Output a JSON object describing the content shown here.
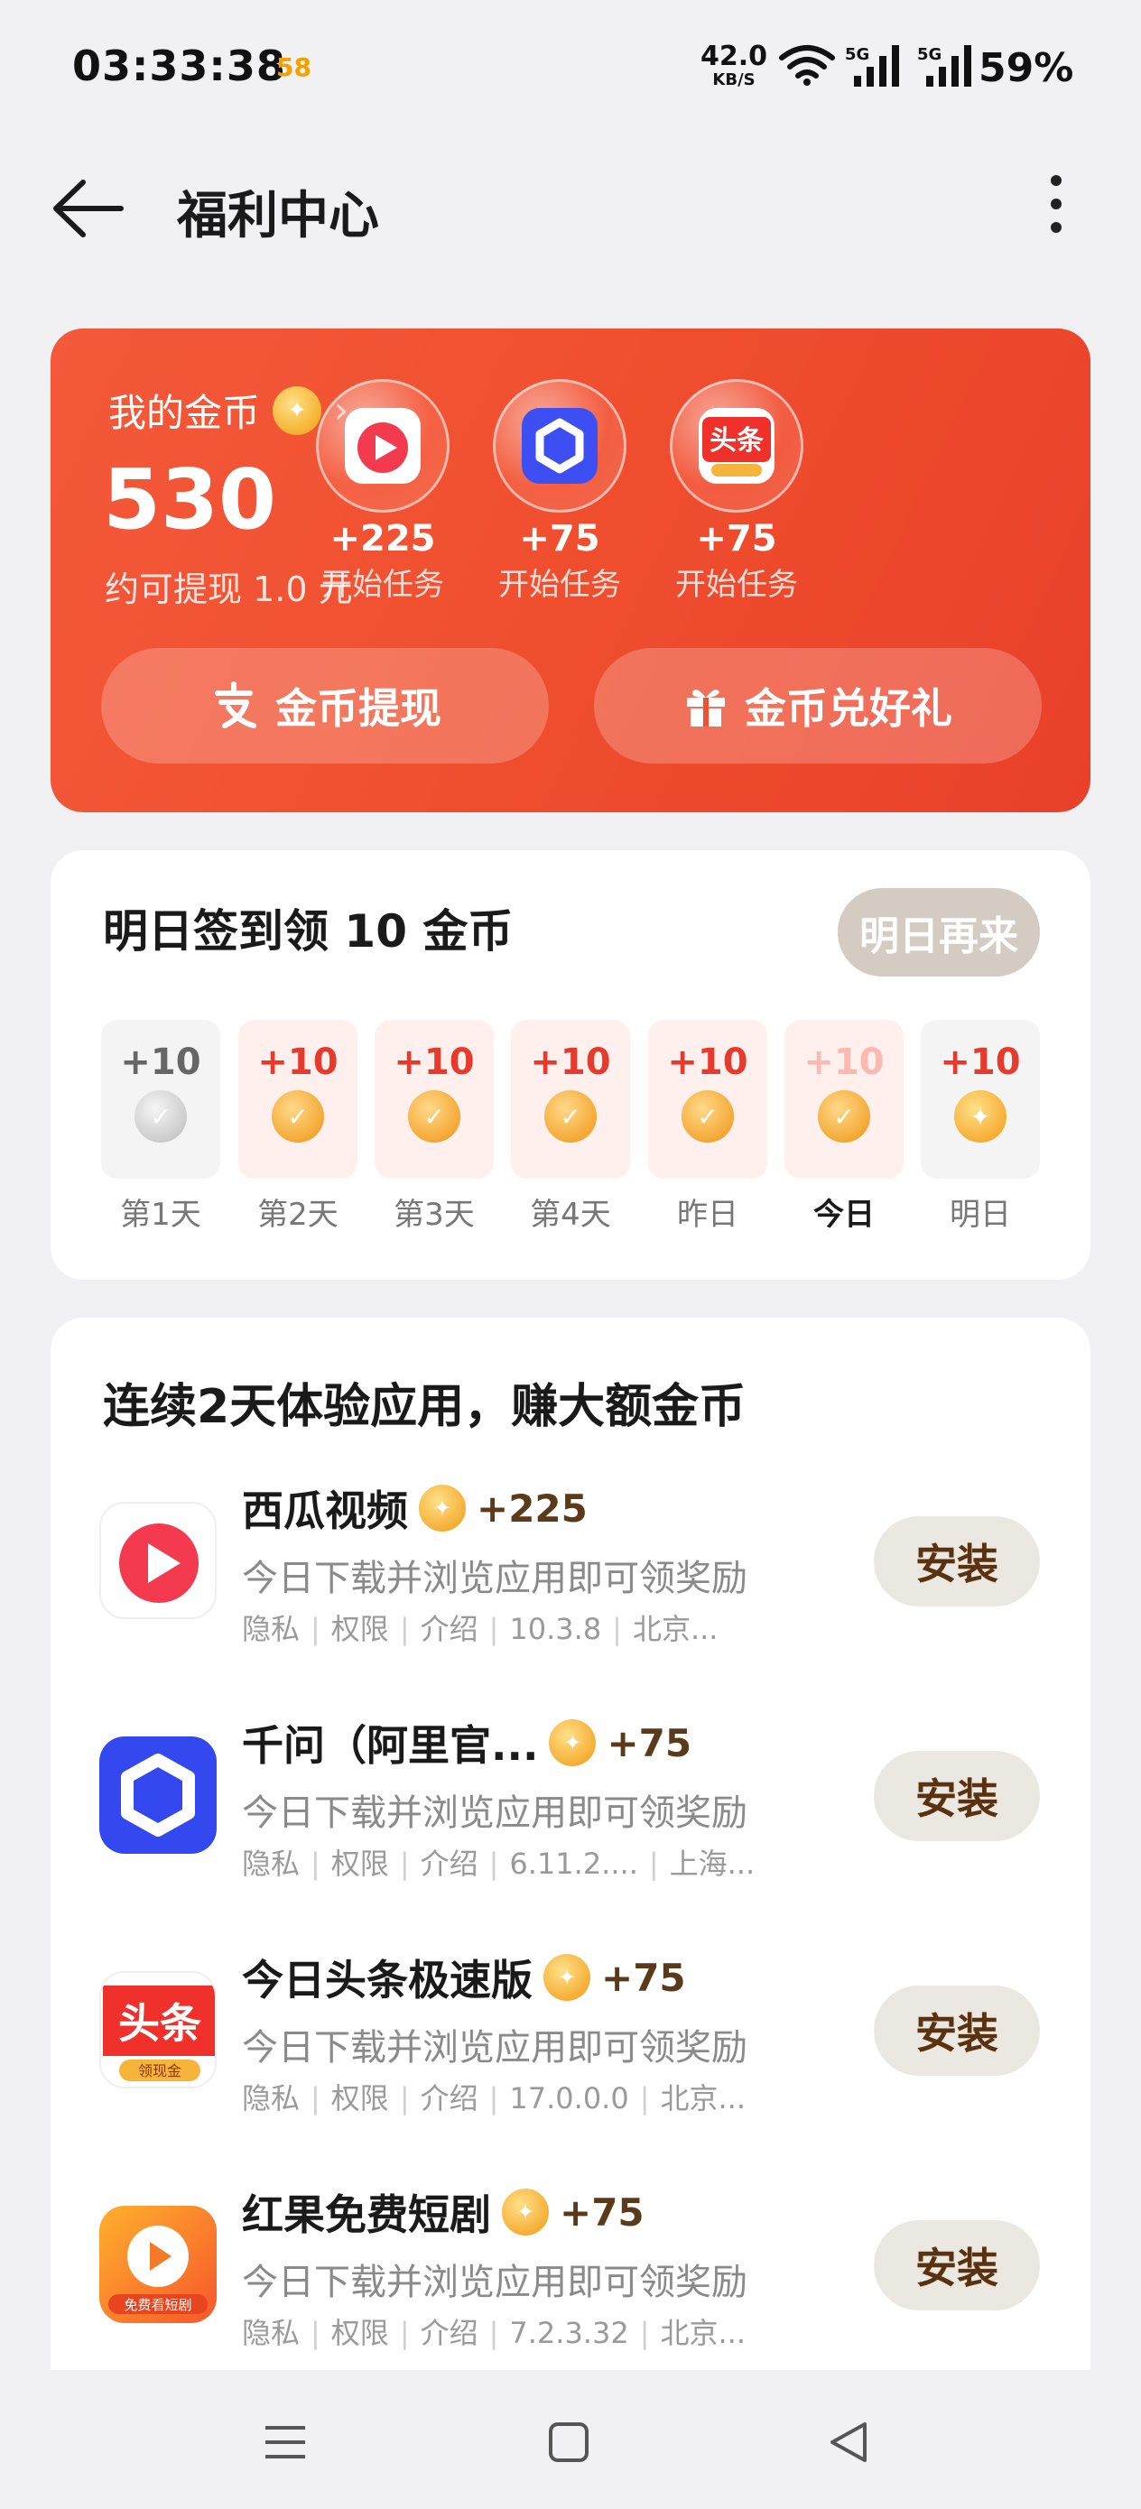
{
  "status_bar": {
    "time": "03:33:38",
    "app_icon_text": "58",
    "speed_value": "42.0",
    "speed_unit": "KB/S",
    "sim1_label": "5G",
    "sim2_label": "5G",
    "battery": "59%"
  },
  "header": {
    "title": "福利中心"
  },
  "coin_card": {
    "label": "我的金币",
    "amount": "530",
    "withdraw_hint": "约可提现 1.0 元",
    "tasks": [
      {
        "amount": "+225",
        "label": "开始任务",
        "icon": "xigua-video-icon"
      },
      {
        "amount": "+75",
        "label": "开始任务",
        "icon": "qianwen-icon"
      },
      {
        "amount": "+75",
        "label": "开始任务",
        "icon": "toutiao-icon"
      }
    ],
    "withdraw_button": "金币提现",
    "gift_button": "金币兑好礼"
  },
  "checkin": {
    "title": "明日签到领 10 金币",
    "button": "明日再来",
    "days": [
      {
        "points": "+10",
        "label": "第1天"
      },
      {
        "points": "+10",
        "label": "第2天"
      },
      {
        "points": "+10",
        "label": "第3天"
      },
      {
        "points": "+10",
        "label": "第4天"
      },
      {
        "points": "+10",
        "label": "昨日"
      },
      {
        "points": "+10",
        "label": "今日"
      },
      {
        "points": "+10",
        "label": "明日"
      }
    ]
  },
  "apps": {
    "title": "连续2天体验应用，赚大额金币",
    "install_label": "安装",
    "meta_labels": [
      "隐私",
      "权限",
      "介绍"
    ],
    "items": [
      {
        "name": "西瓜视频",
        "reward": "+225",
        "desc": "今日下载并浏览应用即可领奖励",
        "version": "10.3.8",
        "developer": "北京..."
      },
      {
        "name": "千问（阿里官...",
        "reward": "+75",
        "desc": "今日下载并浏览应用即可领奖励",
        "version": "6.11.2....",
        "developer": "上海..."
      },
      {
        "name": "今日头条极速版",
        "reward": "+75",
        "desc": "今日下载并浏览应用即可领奖励",
        "version": "17.0.0.0",
        "developer": "北京..."
      },
      {
        "name": "红果免费短剧",
        "reward": "+75",
        "desc": "今日下载并浏览应用即可领奖励",
        "version": "7.2.3.32",
        "developer": "北京..."
      }
    ],
    "icon_texts": {
      "toutiao_main": "头条",
      "toutiao_sub": "领现金",
      "hongguo_sub": "免费看短剧"
    }
  },
  "colors": {
    "accent_red": "#f0502f",
    "points_red": "#e83a2c",
    "install_text": "#5a3210"
  }
}
